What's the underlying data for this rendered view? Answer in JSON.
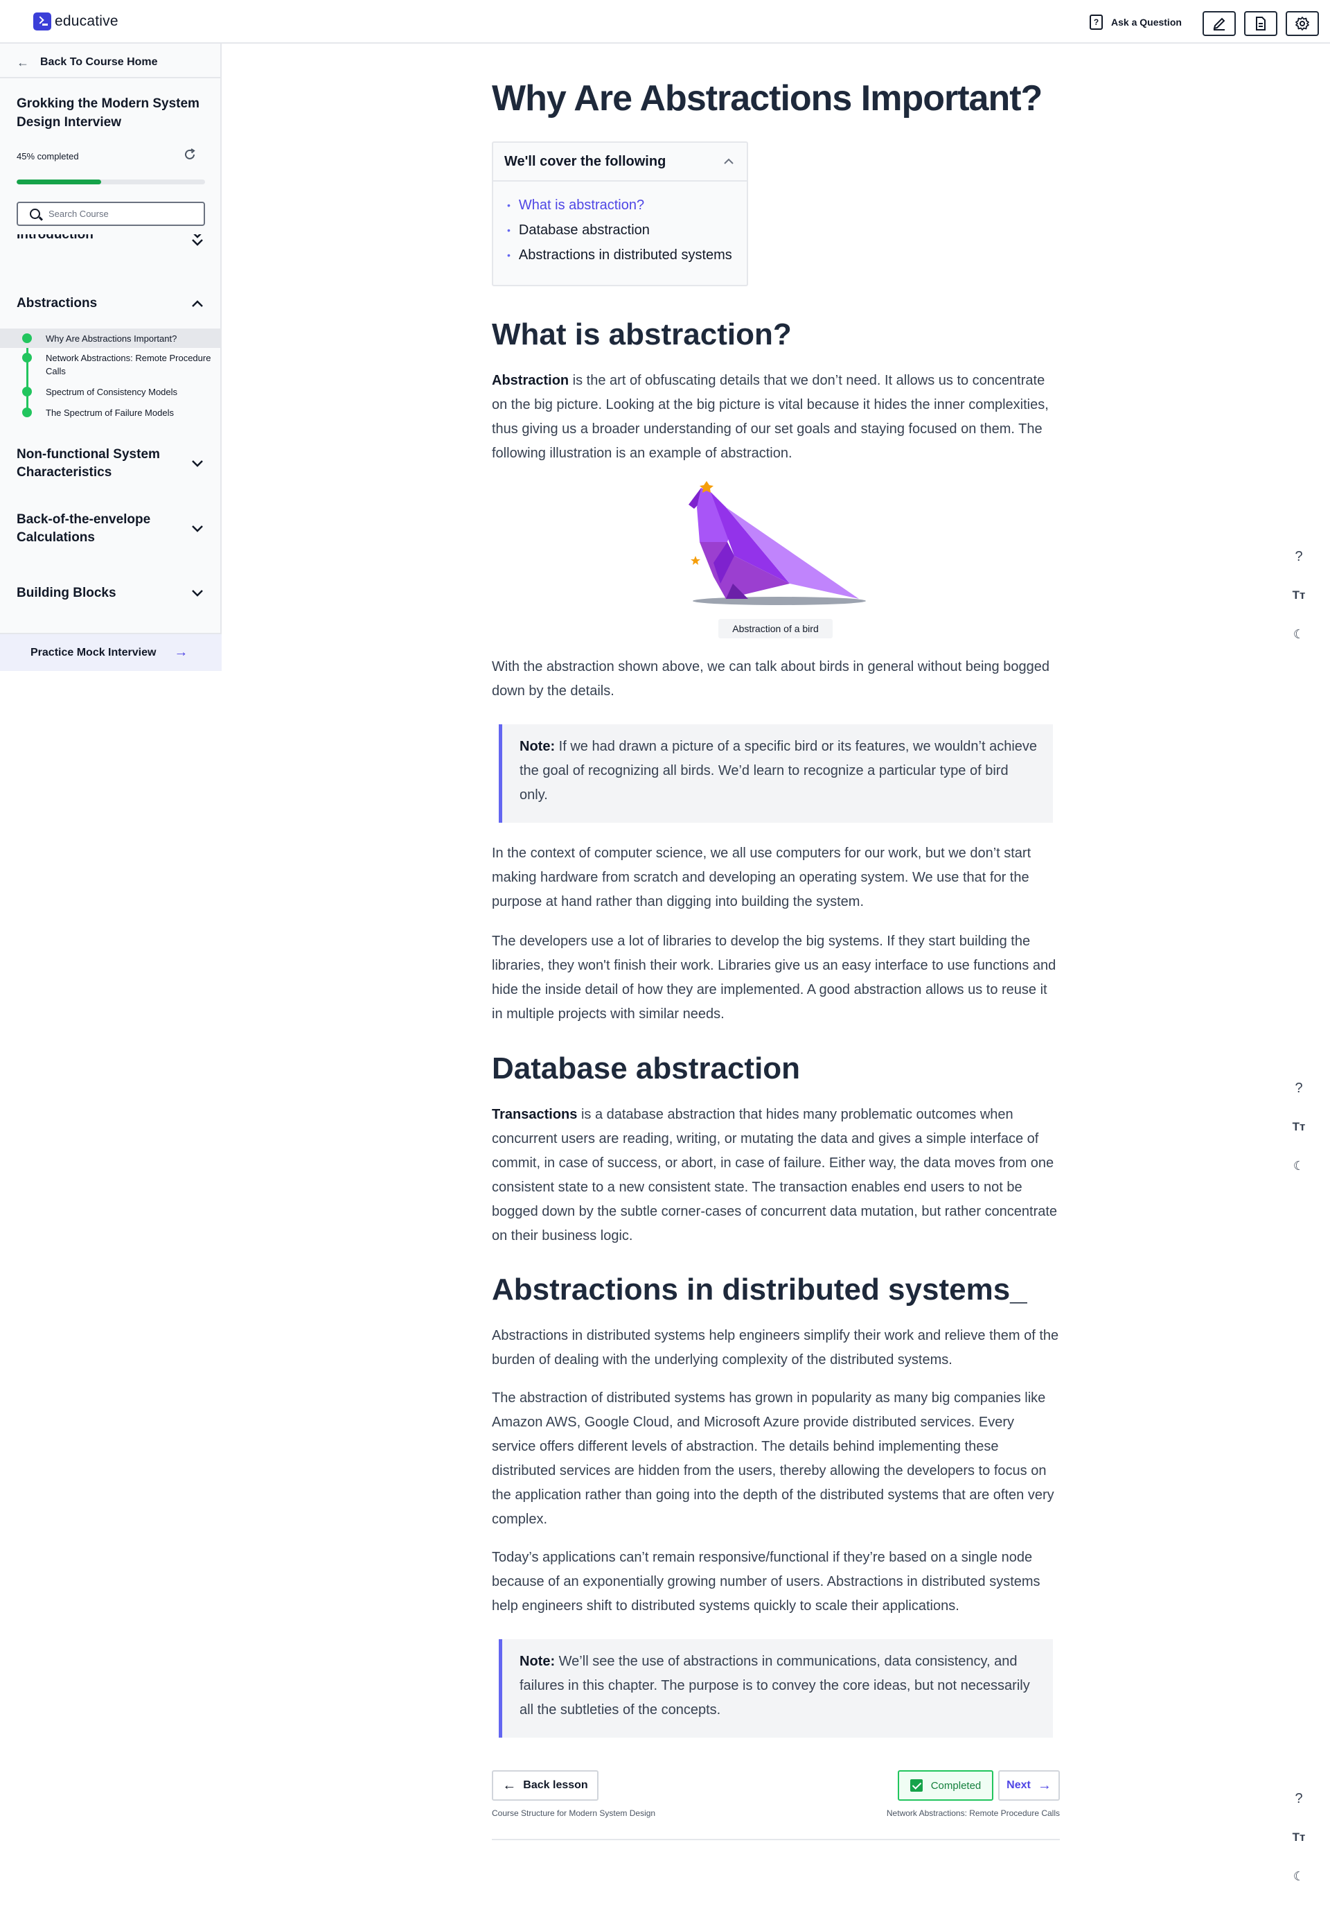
{
  "header": {
    "logo_text": "educative",
    "ask_label": "Ask a Question",
    "tools": [
      "edit-icon",
      "document-icon",
      "settings-icon"
    ]
  },
  "sidebar": {
    "back_label": "Back To Course Home",
    "course_title": "Grokking the Modern System Design Interview",
    "progress_text": "45% completed",
    "progress_fraction": 0.45,
    "search_placeholder": "Search Course",
    "sections": [
      {
        "title": "Introduction",
        "expanded": false
      },
      {
        "title": "Abstractions",
        "expanded": true,
        "lessons": [
          "Why Are Abstractions Important?",
          "Network Abstractions: Remote Procedure Calls",
          "Spectrum of Consistency Models",
          "The Spectrum of Failure Models"
        ]
      },
      {
        "title": "Non-functional System Characteristics",
        "expanded": false
      },
      {
        "title": "Back-of-the-envelope Calculations",
        "expanded": false
      },
      {
        "title": "Building Blocks",
        "expanded": false
      }
    ],
    "mock_label": "Practice Mock Interview"
  },
  "main": {
    "title": "Why Are Abstractions Important?",
    "toc": {
      "heading": "We'll cover the following",
      "items": [
        "What is abstraction?",
        "Database abstraction",
        "Abstractions in distributed systems"
      ]
    },
    "s1": {
      "heading": "What is abstraction?",
      "p1_bold": "Abstraction",
      "p1": " is the art of obfuscating details that we don’t need. It allows us to concentrate on the big picture. Looking at the big picture is vital because it hides the inner complexities, thus giving us a broader understanding of our set goals and staying focused on them. The following illustration is an example of abstraction.",
      "caption": "Abstraction of a bird",
      "p2": "With the abstraction shown above, we can talk about birds in general without being bogged down by the details.",
      "note_label": "Note:",
      "note": " If we had drawn a picture of a specific bird or its features, we wouldn’t achieve the goal of recognizing all birds. We’d learn to recognize a particular type of bird only.",
      "p3": "In the context of computer science, we all use computers for our work, but we don’t start making hardware from scratch and developing an operating system. We use that for the purpose at hand rather than digging into building the system.",
      "p4": "The developers use a lot of libraries to develop the big systems. If they start building the libraries, they won't finish their work. Libraries give us an easy interface to use functions and hide the inside detail of how they are implemented. A good abstraction allows us to reuse it in multiple projects with similar needs."
    },
    "s2": {
      "heading": "Database abstraction",
      "p1_bold": "Transactions",
      "p1": " is a database abstraction that hides many problematic outcomes when concurrent users are reading, writing, or mutating the data and gives a simple interface of commit, in case of success, or abort, in case of failure. Either way, the data moves from one consistent state to a new consistent state. The transaction enables end users to not be bogged down by the subtle corner-cases of concurrent data mutation, but rather concentrate on their business logic."
    },
    "s3": {
      "heading": "Abstractions in distributed systems_",
      "p1": "Abstractions in distributed systems help engineers simplify their work and relieve them of the burden of dealing with the underlying complexity of the distributed systems.",
      "p2": "The abstraction of distributed systems has grown in popularity as many big companies like Amazon AWS, Google Cloud, and Microsoft Azure provide distributed services. Every service offers different levels of abstraction. The details behind implementing these distributed services are hidden from the users, thereby allowing the developers to focus on the application rather than going into the depth of the distributed systems that are often very complex.",
      "p3": "Today’s applications can’t remain responsive/functional if they’re based on a single node because of an exponentially growing number of users. Abstractions in distributed systems help engineers shift to distributed systems quickly to scale their applications.",
      "note_label": "Note:",
      "note": " We’ll see the use of abstractions in communications, data consistency, and failures in this chapter. The purpose is to convey the core ideas, but not necessarily all the subtleties of the concepts."
    },
    "nav": {
      "back_label": "Back lesson",
      "back_sub": "Course Structure for Modern System Design",
      "completed_label": "Completed",
      "next_label": "Next",
      "next_sub": "Network Abstractions: Remote Procedure Calls"
    },
    "side_tools": [
      "help-icon",
      "font-size-icon",
      "dark-mode-icon"
    ]
  },
  "colors": {
    "accent": "#4f46e5",
    "progress": "#16a34a",
    "bird": "#9b3fd0"
  }
}
